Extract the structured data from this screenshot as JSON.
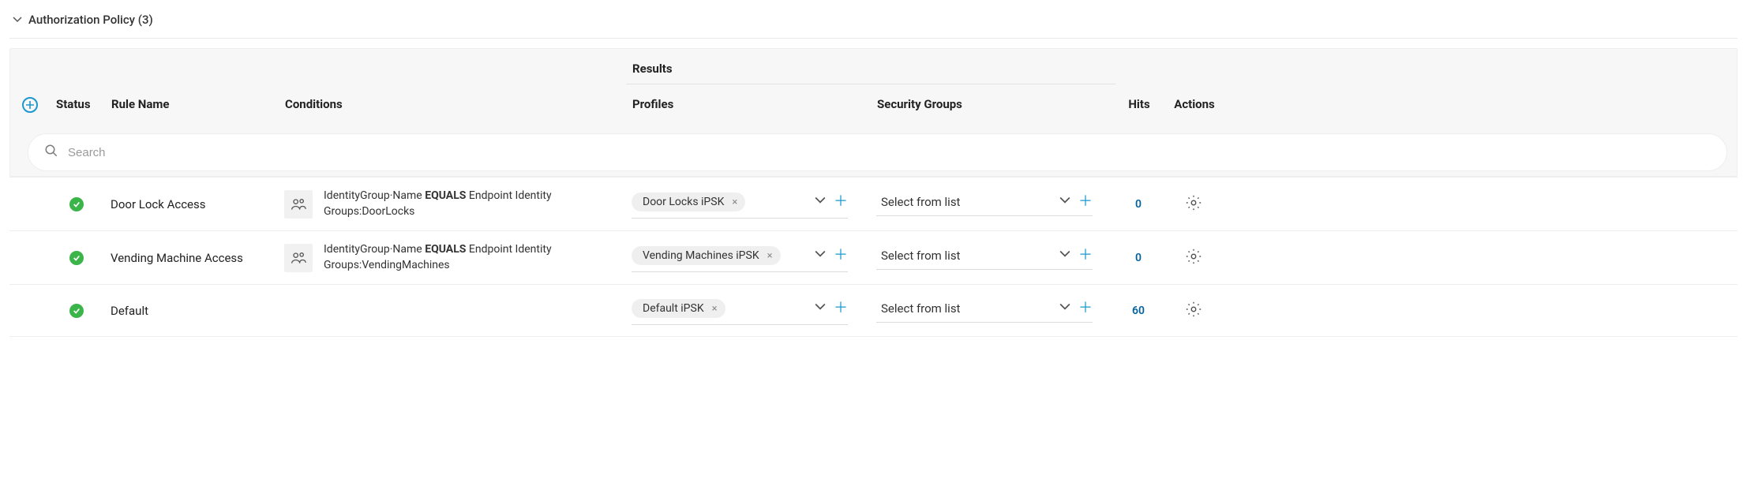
{
  "section": {
    "title": "Authorization Policy (3)"
  },
  "headers": {
    "status": "Status",
    "rule_name": "Rule Name",
    "conditions": "Conditions",
    "results": "Results",
    "profiles": "Profiles",
    "security_groups": "Security Groups",
    "hits": "Hits",
    "actions": "Actions"
  },
  "search": {
    "placeholder": "Search"
  },
  "security_group_placeholder": "Select from list",
  "rows": [
    {
      "status": "ok",
      "rule_name": "Door Lock Access",
      "condition_attr": "IdentityGroup·Name",
      "condition_op": "EQUALS",
      "condition_val": "Endpoint Identity Groups:DoorLocks",
      "has_condition_icon": true,
      "profile_chip": "Door Locks iPSK",
      "security_group": "Select from list",
      "hits": "0"
    },
    {
      "status": "ok",
      "rule_name": "Vending Machine Access",
      "condition_attr": "IdentityGroup·Name",
      "condition_op": "EQUALS",
      "condition_val": "Endpoint Identity Groups:VendingMachines",
      "has_condition_icon": true,
      "profile_chip": "Vending Machines iPSK",
      "security_group": "Select from list",
      "hits": "0"
    },
    {
      "status": "ok",
      "rule_name": "Default",
      "condition_attr": "",
      "condition_op": "",
      "condition_val": "",
      "has_condition_icon": false,
      "profile_chip": "Default iPSK",
      "security_group": "Select from list",
      "hits": "60"
    }
  ]
}
